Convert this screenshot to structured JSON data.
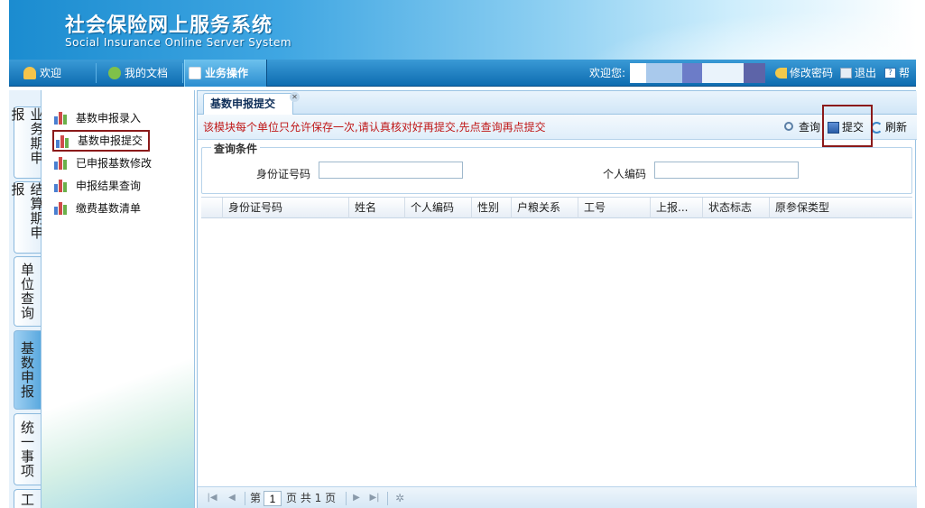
{
  "header": {
    "title_cn": "社会保险网上服务系统",
    "title_en": "Social Insurance Online Server System"
  },
  "navbar": {
    "items": [
      {
        "label": "欢迎",
        "icon": "person-icon"
      },
      {
        "label": "我的文档",
        "icon": "documents-icon"
      },
      {
        "label": "业务操作",
        "icon": "business-icon",
        "active": true
      }
    ],
    "welcome": "欢迎您:",
    "links": [
      {
        "label": "修改密码",
        "icon": "key-icon"
      },
      {
        "label": "退出",
        "icon": "exit-icon"
      },
      {
        "label": "帮助",
        "icon": "help-icon"
      }
    ]
  },
  "vtabs": [
    {
      "label": "业务期申报"
    },
    {
      "label": "结算期申报"
    },
    {
      "label": "单位查询"
    },
    {
      "label": "基数申报",
      "active": true
    },
    {
      "label": "统一事项"
    },
    {
      "label": "工"
    }
  ],
  "menu": {
    "items": [
      {
        "label": "基数申报录入"
      },
      {
        "label": "基数申报提交",
        "selected": true
      },
      {
        "label": "已申报基数修改"
      },
      {
        "label": "申报结果查询"
      },
      {
        "label": "缴费基数清单"
      }
    ]
  },
  "main": {
    "tab_label": "基数申报提交",
    "notice": "该模块每个单位只允许保存一次,请认真核对好再提交,先点查询再点提交",
    "toolbar": {
      "query": "查询",
      "submit": "提交",
      "refresh": "刷新"
    },
    "query_panel": {
      "legend": "查询条件",
      "id_label": "身份证号码",
      "id_value": "",
      "personal_code_label": "个人编码",
      "personal_code_value": ""
    },
    "columns": [
      "身份证号码",
      "姓名",
      "个人编码",
      "性别",
      "户粮关系",
      "工号",
      "上报...",
      "状态标志",
      "原参保类型"
    ],
    "rows": [],
    "pager": {
      "prefix": "第",
      "page": "1",
      "suffix": "页 共 1 页"
    }
  },
  "colors": {
    "header_blue": "#1b8cd0",
    "nav_blue": "#0e6cb0",
    "notice_red": "#c01818",
    "highlight_border": "#8b1a1a"
  }
}
